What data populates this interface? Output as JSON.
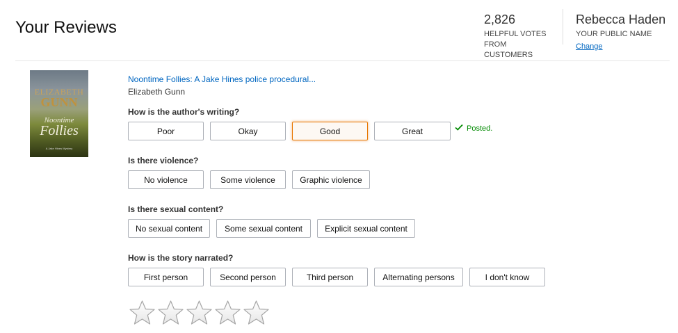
{
  "header": {
    "title": "Your Reviews",
    "votes": {
      "count": "2,826",
      "label_line1": "HELPFUL VOTES",
      "label_line2": "FROM CUSTOMERS"
    },
    "profile": {
      "name": "Rebecca Haden",
      "label": "YOUR PUBLIC NAME",
      "change_link": "Change"
    }
  },
  "book": {
    "title": "Noontime Follies: A Jake Hines police procedural...",
    "author": "Elizabeth Gunn",
    "cover": {
      "author_line1": "ELIZABETH",
      "author_line2": "GUNN",
      "title_line1": "Noontime",
      "title_line2": "Follies",
      "subtitle": "A Jake Hines Mystery"
    }
  },
  "questions": [
    {
      "prompt": "How is the author's writing?",
      "options": [
        "Poor",
        "Okay",
        "Good",
        "Great"
      ],
      "selected": "Good",
      "status": "Posted."
    },
    {
      "prompt": "Is there violence?",
      "options": [
        "No violence",
        "Some violence",
        "Graphic violence"
      ]
    },
    {
      "prompt": "Is there sexual content?",
      "options": [
        "No sexual content",
        "Some sexual content",
        "Explicit sexual content"
      ]
    },
    {
      "prompt": "How is the story narrated?",
      "options": [
        "First person",
        "Second person",
        "Third person",
        "Alternating persons",
        "I don't know"
      ]
    }
  ],
  "rating": {
    "stars_total": 5,
    "stars_filled": 0
  },
  "colors": {
    "link": "#0066c0",
    "posted_green": "#008a00",
    "selected_border": "#e77600"
  },
  "icons": {
    "posted": "checkmark-icon",
    "star": "star-outline-icon"
  }
}
